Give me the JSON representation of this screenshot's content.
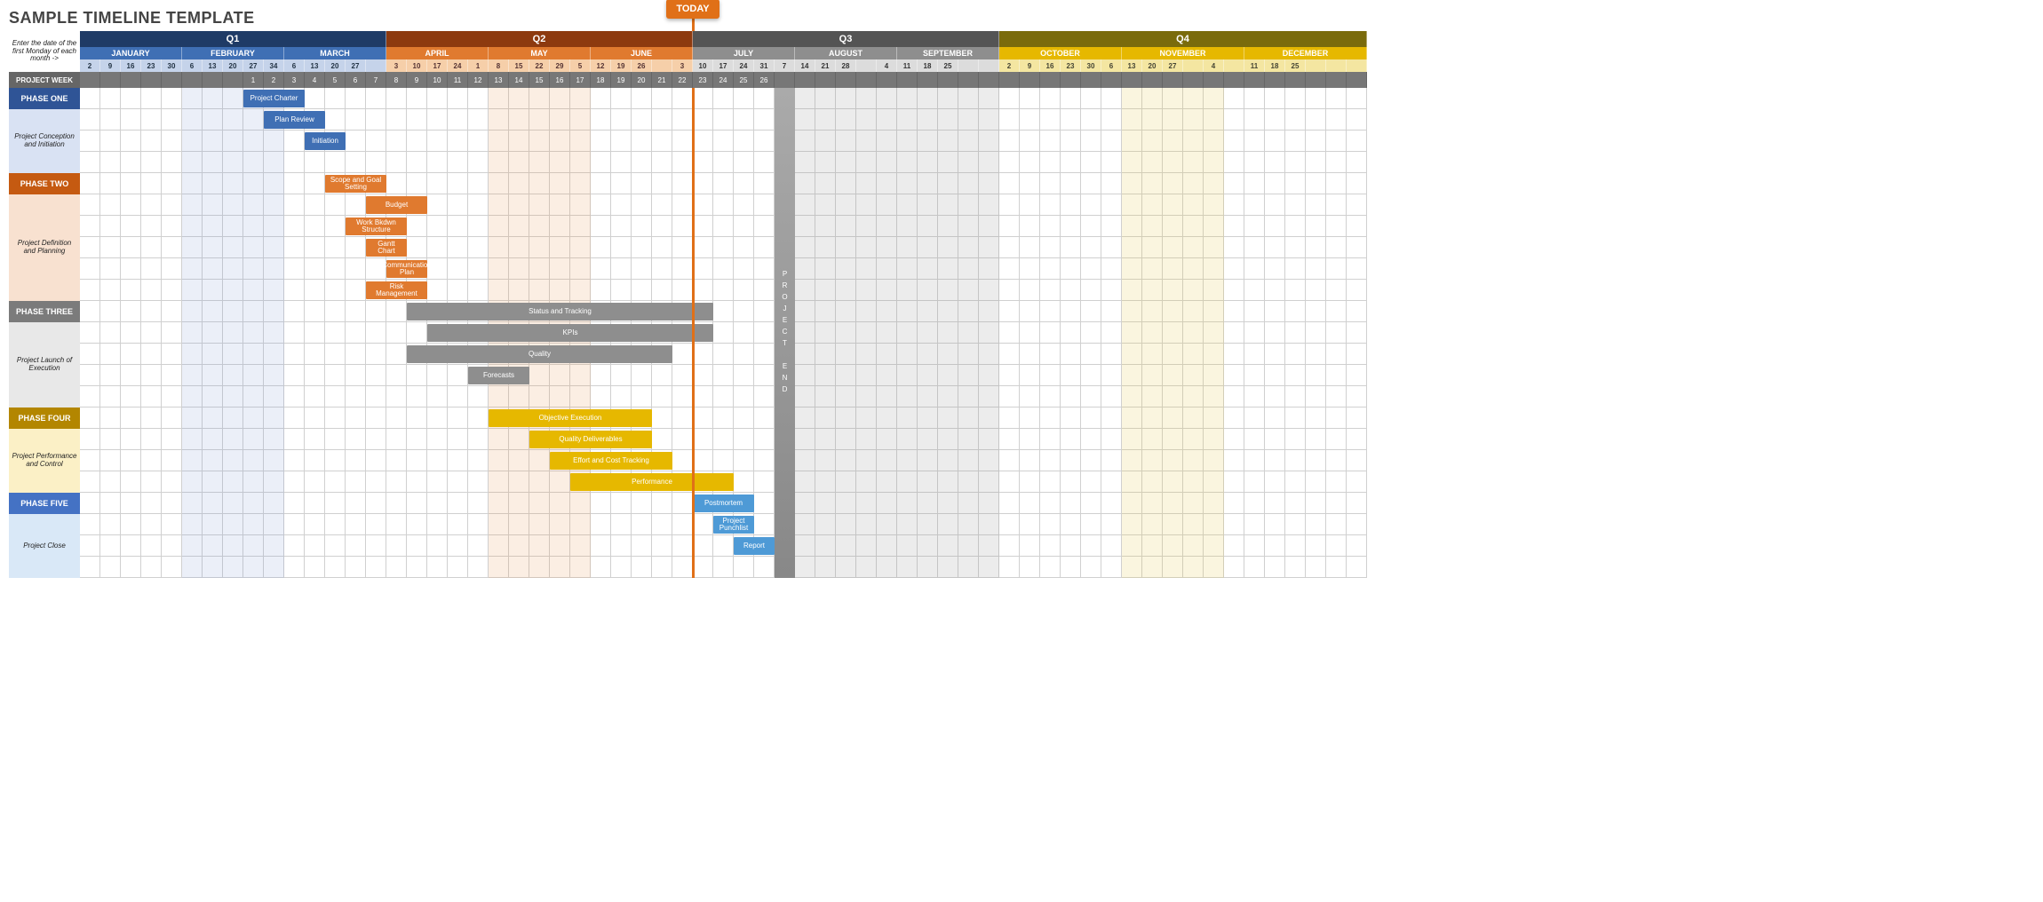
{
  "title": "SAMPLE TIMELINE TEMPLATE",
  "hint": "Enter the date of the first Monday of each month ->",
  "today_label": "TODAY",
  "project_week_label": "PROJECT WEEK",
  "project_end_label": "PROJECT END",
  "weeks_total": 63,
  "today_week": 30,
  "project_end_week": 34,
  "quarters": [
    {
      "name": "Q1",
      "span": 15,
      "cls": "q1",
      "mcls": "q1m",
      "dcls": "q1d",
      "months": [
        {
          "name": "JANUARY",
          "days": [
            "2",
            "9",
            "16",
            "23",
            "30"
          ]
        },
        {
          "name": "FEBRUARY",
          "days": [
            "6",
            "13",
            "20",
            "27",
            "34"
          ]
        },
        {
          "name": "MARCH",
          "days": [
            "6",
            "13",
            "20",
            "27",
            ""
          ]
        }
      ]
    },
    {
      "name": "Q2",
      "span": 15,
      "cls": "q2",
      "mcls": "q2m",
      "dcls": "q2d",
      "months": [
        {
          "name": "APRIL",
          "days": [
            "3",
            "10",
            "17",
            "24",
            "1"
          ]
        },
        {
          "name": "MAY",
          "days": [
            "8",
            "15",
            "22",
            "29",
            "5"
          ]
        },
        {
          "name": "JUNE",
          "days": [
            "12",
            "19",
            "26",
            "",
            "3"
          ]
        }
      ]
    },
    {
      "name": "Q3",
      "span": 15,
      "cls": "q3",
      "mcls": "q3m",
      "dcls": "q3d",
      "months": [
        {
          "name": "JULY",
          "days": [
            "10",
            "17",
            "24",
            "31",
            "7"
          ]
        },
        {
          "name": "AUGUST",
          "days": [
            "14",
            "21",
            "28",
            "",
            "4"
          ]
        },
        {
          "name": "SEPTEMBER",
          "days": [
            "11",
            "18",
            "25",
            "",
            ""
          ]
        }
      ]
    },
    {
      "name": "Q4",
      "span": 18,
      "cls": "q4",
      "mcls": "q4m",
      "dcls": "q4d",
      "months": [
        {
          "name": "OCTOBER",
          "days": [
            "2",
            "9",
            "16",
            "23",
            "30",
            "6"
          ]
        },
        {
          "name": "NOVEMBER",
          "days": [
            "13",
            "20",
            "27",
            "",
            "4",
            ""
          ]
        },
        {
          "name": "DECEMBER",
          "days": [
            "11",
            "18",
            "25",
            "",
            "",
            ""
          ]
        }
      ]
    }
  ],
  "project_weeks": [
    "",
    "",
    "",
    "",
    "",
    "",
    "",
    "",
    "1",
    "2",
    "3",
    "4",
    "5",
    "6",
    "7",
    "8",
    "9",
    "10",
    "11",
    "12",
    "13",
    "14",
    "15",
    "16",
    "17",
    "18",
    "19",
    "20",
    "21",
    "22",
    "23",
    "24",
    "25",
    "26",
    "",
    "",
    "",
    "",
    "",
    "",
    "",
    "",
    "",
    "",
    "",
    "",
    "",
    "",
    "",
    "",
    "",
    "",
    "",
    "",
    "",
    "",
    "",
    "",
    "",
    "",
    "",
    "",
    ""
  ],
  "phases": [
    {
      "header": "PHASE ONE",
      "desc": "Project Conception and Initiation",
      "hcls": "p1h",
      "dcls": "p1d",
      "rows": 4
    },
    {
      "header": "PHASE TWO",
      "desc": "Project Definition and Planning",
      "hcls": "p2h",
      "dcls": "p2d",
      "rows": 6
    },
    {
      "header": "PHASE THREE",
      "desc": "Project Launch of Execution",
      "hcls": "p3h",
      "dcls": "p3d",
      "rows": 5
    },
    {
      "header": "PHASE FOUR",
      "desc": "Project Performance and Control",
      "hcls": "p4h",
      "dcls": "p4d",
      "rows": 4
    },
    {
      "header": "PHASE FIVE",
      "desc": "Project Close",
      "hcls": "p5h",
      "dcls": "p5d",
      "rows": 4
    }
  ],
  "bands": [
    {
      "start": 5,
      "span": 5,
      "cls": "b-lblue"
    },
    {
      "start": 20,
      "span": 5,
      "cls": "b-lorange"
    },
    {
      "start": 35,
      "span": 10,
      "cls": "b-lgray"
    },
    {
      "start": 51,
      "span": 5,
      "cls": "b-lyellow"
    }
  ],
  "bars": [
    {
      "row": 0,
      "start": 8,
      "span": 3,
      "label": "Project Charter",
      "color": "c-blue"
    },
    {
      "row": 1,
      "start": 9,
      "span": 3,
      "label": "Plan Review",
      "color": "c-blue"
    },
    {
      "row": 2,
      "start": 11,
      "span": 2,
      "label": "Initiation",
      "color": "c-blue"
    },
    {
      "row": 4,
      "start": 12,
      "span": 3,
      "label": "Scope and Goal Setting",
      "color": "c-orange"
    },
    {
      "row": 5,
      "start": 14,
      "span": 3,
      "label": "Budget",
      "color": "c-orange"
    },
    {
      "row": 6,
      "start": 13,
      "span": 3,
      "label": "Work Bkdwn Structure",
      "color": "c-orange"
    },
    {
      "row": 7,
      "start": 14,
      "span": 2,
      "label": "Gantt Chart",
      "color": "c-orange"
    },
    {
      "row": 8,
      "start": 15,
      "span": 2,
      "label": "Communication Plan",
      "color": "c-orange"
    },
    {
      "row": 9,
      "start": 14,
      "span": 3,
      "label": "Risk Management",
      "color": "c-orange"
    },
    {
      "row": 10,
      "start": 16,
      "span": 15,
      "label": "Status  and Tracking",
      "color": "c-gray"
    },
    {
      "row": 11,
      "start": 17,
      "span": 14,
      "label": "KPIs",
      "color": "c-gray"
    },
    {
      "row": 12,
      "start": 16,
      "span": 13,
      "label": "Quality",
      "color": "c-gray"
    },
    {
      "row": 13,
      "start": 19,
      "span": 3,
      "label": "Forecasts",
      "color": "c-gray"
    },
    {
      "row": 15,
      "start": 20,
      "span": 8,
      "label": "Objective Execution",
      "color": "c-yellow"
    },
    {
      "row": 16,
      "start": 22,
      "span": 6,
      "label": "Quality Deliverables",
      "color": "c-yellow"
    },
    {
      "row": 17,
      "start": 23,
      "span": 6,
      "label": "Effort and Cost Tracking",
      "color": "c-yellow"
    },
    {
      "row": 18,
      "start": 24,
      "span": 8,
      "label": "Performance",
      "color": "c-yellow"
    },
    {
      "row": 19,
      "start": 30,
      "span": 3,
      "label": "Postmortem",
      "color": "c-lightblue"
    },
    {
      "row": 20,
      "start": 31,
      "span": 2,
      "label": "Project Punchlist",
      "color": "c-lightblue"
    },
    {
      "row": 21,
      "start": 32,
      "span": 2,
      "label": "Report",
      "color": "c-lightblue"
    }
  ],
  "chart_data": {
    "type": "gantt",
    "title": "SAMPLE TIMELINE TEMPLATE",
    "x_unit": "project week (1 = first labelled week)",
    "today_week": 23,
    "project_end_week": 27,
    "phases": [
      {
        "name": "PHASE ONE",
        "desc": "Project Conception and Initiation",
        "color": "#3f6fb4",
        "tasks": [
          {
            "name": "Project Charter",
            "start": 1,
            "span": 3
          },
          {
            "name": "Plan Review",
            "start": 2,
            "span": 3
          },
          {
            "name": "Initiation",
            "start": 4,
            "span": 2
          }
        ]
      },
      {
        "name": "PHASE TWO",
        "desc": "Project Definition and Planning",
        "color": "#e07a2f",
        "tasks": [
          {
            "name": "Scope and Goal Setting",
            "start": 5,
            "span": 3
          },
          {
            "name": "Budget",
            "start": 7,
            "span": 3
          },
          {
            "name": "Work Bkdwn Structure",
            "start": 6,
            "span": 3
          },
          {
            "name": "Gantt Chart",
            "start": 7,
            "span": 2
          },
          {
            "name": "Communication Plan",
            "start": 8,
            "span": 2
          },
          {
            "name": "Risk Management",
            "start": 7,
            "span": 3
          }
        ]
      },
      {
        "name": "PHASE THREE",
        "desc": "Project Launch of Execution",
        "color": "#8e8e8e",
        "tasks": [
          {
            "name": "Status and Tracking",
            "start": 9,
            "span": 15
          },
          {
            "name": "KPIs",
            "start": 10,
            "span": 14
          },
          {
            "name": "Quality",
            "start": 9,
            "span": 13
          },
          {
            "name": "Forecasts",
            "start": 12,
            "span": 3
          }
        ]
      },
      {
        "name": "PHASE FOUR",
        "desc": "Project Performance and Control",
        "color": "#e6b800",
        "tasks": [
          {
            "name": "Objective Execution",
            "start": 13,
            "span": 8
          },
          {
            "name": "Quality Deliverables",
            "start": 15,
            "span": 6
          },
          {
            "name": "Effort and Cost Tracking",
            "start": 16,
            "span": 6
          },
          {
            "name": "Performance",
            "start": 17,
            "span": 8
          }
        ]
      },
      {
        "name": "PHASE FIVE",
        "desc": "Project Close",
        "color": "#4e9ad6",
        "tasks": [
          {
            "name": "Postmortem",
            "start": 23,
            "span": 3
          },
          {
            "name": "Project Punchlist",
            "start": 24,
            "span": 2
          },
          {
            "name": "Report",
            "start": 25,
            "span": 2
          }
        ]
      }
    ]
  }
}
